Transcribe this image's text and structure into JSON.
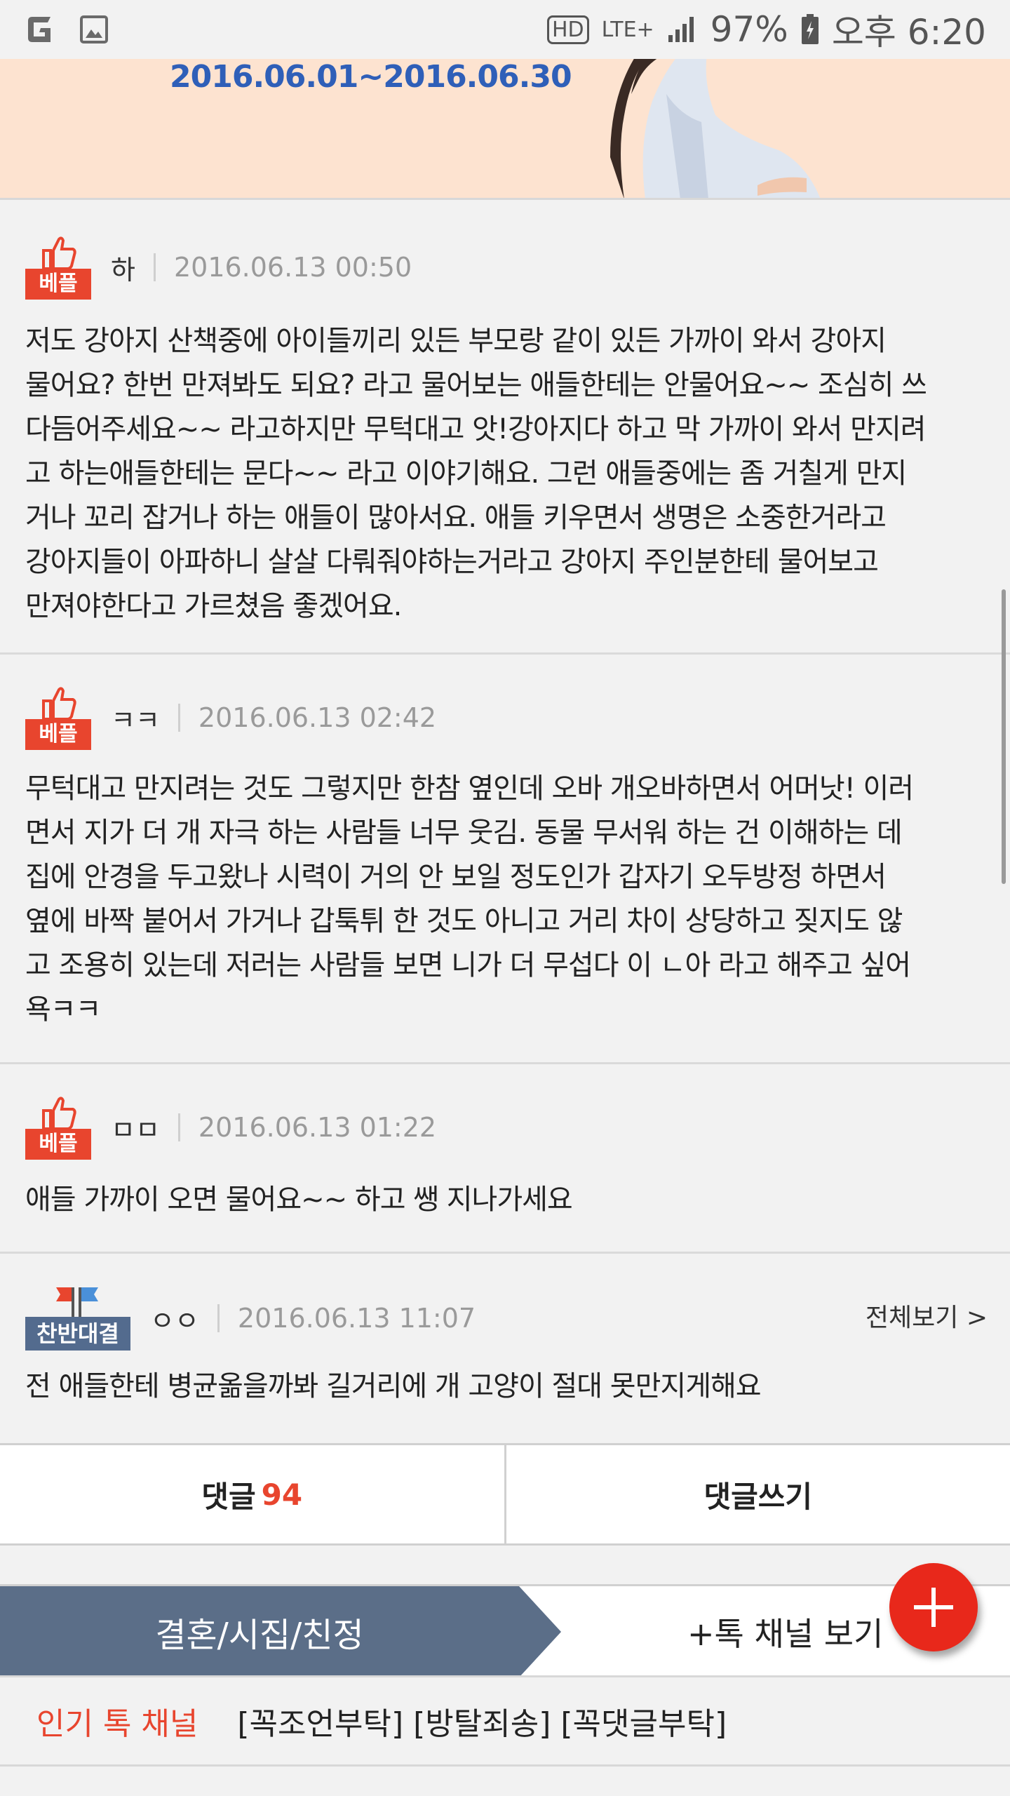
{
  "status_bar": {
    "network_hd": "HD",
    "network_lte": "LTE+",
    "battery": "97%",
    "time": "오후 6:20",
    "icons": [
      "app-g-icon",
      "gallery-icon",
      "hd-voice-icon",
      "lte-icon",
      "signal-icon",
      "battery-icon"
    ]
  },
  "banner": {
    "date_range": "2016.06.01~2016.06.30"
  },
  "comments": [
    {
      "badge": "베플",
      "author": "하",
      "date": "2016.06.13 00:50",
      "body": "저도 강아지 산책중에 아이들끼리 있든 부모랑 같이 있든 가까이 와서 강아지\n물어요? 한번 만져봐도 되요? 라고 물어보는 애들한테는 안물어요~~ 조심히 쓰\n다듬어주세요~~ 라고하지만 무턱대고 앗!강아지다 하고 막 가까이 와서 만지려\n고 하는애들한테는 문다~~ 라고 이야기해요. 그런 애들중에는 좀 거칠게 만지\n거나 꼬리 잡거나 하는 애들이 많아서요. 애들 키우면서 생명은 소중한거라고\n강아지들이 아파하니 살살 다뤄줘야하는거라고 강아지 주인분한테 물어보고\n만져야한다고 가르쳤음 좋겠어요."
    },
    {
      "badge": "베플",
      "author": "ㅋㅋ",
      "date": "2016.06.13 02:42",
      "body": "무턱대고 만지려는 것도 그렇지만 한참 옆인데 오바 개오바하면서 어머낫! 이러\n면서 지가 더 개 자극 하는 사람들 너무 웃김. 동물 무서워 하는 건 이해하는 데\n집에 안경을 두고왔나 시력이 거의 안 보일 정도인가 갑자기 오두방정 하면서\n옆에 바짝 붙어서 가거나 갑툭튀 한 것도 아니고 거리 차이 상당하고 짖지도 않\n고 조용히 있는데 저러는 사람들 보면 니가 더 무섭다 이 ㄴ아 라고 해주고 싶어\n욕ㅋㅋ"
    },
    {
      "badge": "베플",
      "author": "ㅁㅁ",
      "date": "2016.06.13 01:22",
      "body": "애들 가까이 오면 물어요~~ 하고 쌩 지나가세요"
    },
    {
      "badge": "찬반대결",
      "author": "ㅇㅇ",
      "date": "2016.06.13 11:07",
      "view_all": "전체보기 >",
      "body": "전 애들한테 병균옮을까봐 길거리에 개 고양이 절대 못만지게해요"
    }
  ],
  "actions": {
    "comments_label": "댓글",
    "comments_count": "94",
    "write_label": "댓글쓰기"
  },
  "channel": {
    "tag": "결혼/시집/친정",
    "more": "+톡 채널 보기",
    "fab_icon": "plus-icon"
  },
  "popular": {
    "label": "인기 톡 채널",
    "tags": [
      "[꼭조언부탁]",
      "[방탈죄송]",
      "[꼭댓글부탁]"
    ]
  },
  "colors": {
    "accent": "#e8452e",
    "badge_debate": "#536b8e",
    "banner_bg": "#fde3d0",
    "banner_date": "#2f5fb8",
    "fab": "#e8281b"
  }
}
